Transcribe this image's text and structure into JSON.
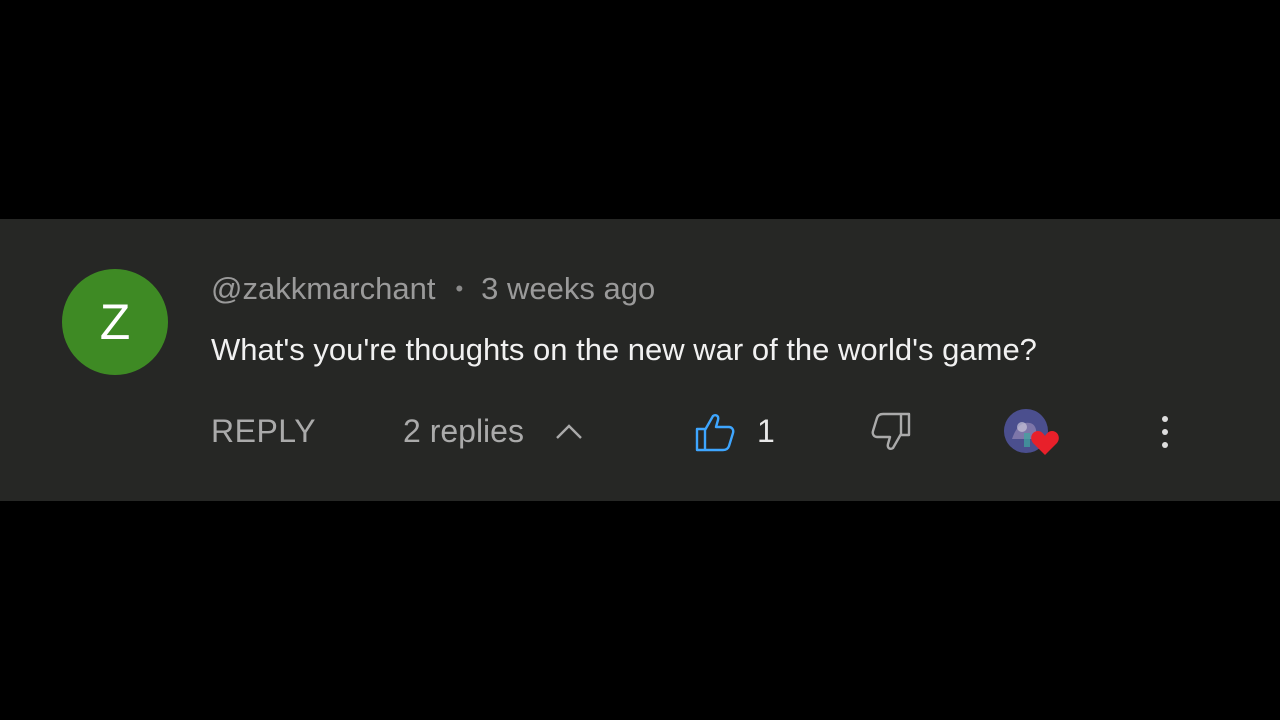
{
  "comment": {
    "avatar_letter": "Z",
    "avatar_color": "#3e8a24",
    "author": "@zakkmarchant",
    "separator": "•",
    "timestamp": "3 weeks ago",
    "text": "What's you're thoughts on the new war of the world's game?"
  },
  "actions": {
    "reply_label": "REPLY",
    "replies_label": "2 replies",
    "like_count": "1",
    "like_icon_color": "#3ea6ff",
    "dislike_icon_color": "#aaaaaa",
    "heart_color": "#e8202a",
    "icons": {
      "chevron": "chevron-up-icon",
      "like": "thumbs-up-icon",
      "dislike": "thumbs-down-icon",
      "heart": "heart-icon",
      "more": "vertical-ellipsis-icon"
    }
  }
}
